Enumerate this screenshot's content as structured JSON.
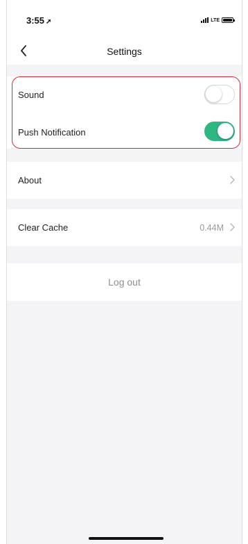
{
  "status_bar": {
    "time": "3:55",
    "location_arrow": "➚",
    "network": "LTE",
    "icons": [
      "signal-icon",
      "battery-icon"
    ]
  },
  "nav": {
    "title": "Settings",
    "back_icon": "chevron-left-icon"
  },
  "notifications_group": {
    "items": [
      {
        "label": "Sound",
        "toggle": "off"
      },
      {
        "label": "Push Notification",
        "toggle": "on"
      }
    ]
  },
  "about": {
    "label": "About",
    "icon": "chevron-right-icon"
  },
  "cache": {
    "label": "Clear Cache",
    "value": "0.44M",
    "icon": "chevron-right-icon"
  },
  "logout": {
    "label": "Log out"
  },
  "colors": {
    "accent_toggle_on": "#2fb783",
    "highlight_border": "#d52a3c",
    "background": "#f4f4f6"
  }
}
